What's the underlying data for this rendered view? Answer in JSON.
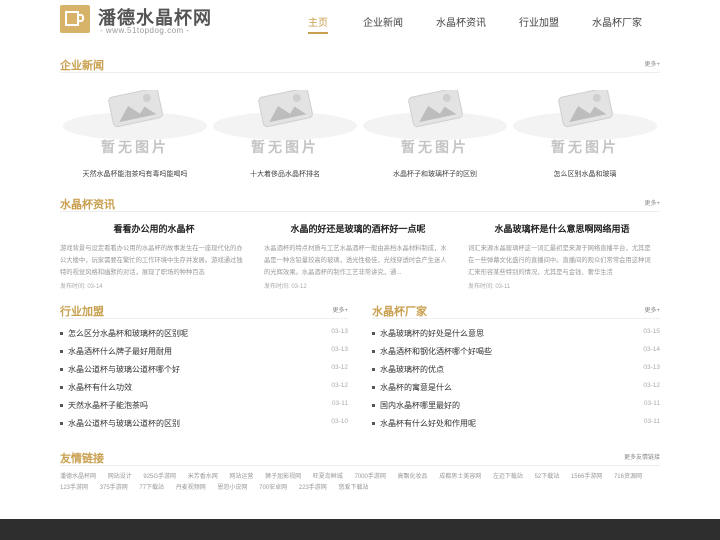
{
  "header": {
    "title": "潘德水晶杯网",
    "subtitle": "- www.51topdog.com -",
    "nav": [
      "主页",
      "企业新闻",
      "水晶杯资讯",
      "行业加盟",
      "水晶杯厂家"
    ]
  },
  "enterprise_news": {
    "title": "企业新闻",
    "more": "更多+",
    "placeholder": "暂无图片",
    "cards": [
      "天然水晶杯能泡茶吗有毒吗能喝吗",
      "十大着侈品水晶杯排名",
      "水晶杯子和玻璃杯子的区别",
      "怎么区别水晶和玻璃"
    ]
  },
  "crystal_info": {
    "title": "水晶杯资讯",
    "more": "更多+",
    "items": [
      {
        "title": "看看办公用的水晶杯",
        "body": "游戏背景与设定看看办公用的水晶杯的故事发生在一座现代化的办公大楼中，玩家需要在繁忙的工作环境中生存并发展。游戏通过独特的视觉风格和幽默的对话，展现了职场的种种百态",
        "time": "发布时间:  03-14"
      },
      {
        "title": "水晶的好还是玻璃的酒杯好一点呢",
        "body": "水晶酒杯的特点材质与工艺水晶酒杯一般由高档水晶材料制成，水晶是一种含铅量较高的玻璃，透光性极佳，光线穿透时会产生迷人的光辉效果。水晶酒杯的制作工艺非常讲究，通...",
        "time": "发布时间:  03-12"
      },
      {
        "title": "水晶玻璃杯是什么意思啊网络用语",
        "body": "词汇来源水晶玻璃杯这一词汇最初是来源于网络直播平台，尤其是在一些弹幕文化盛行的直播间中。直播间的观众们常常会用这种词汇来形容某些特别的情况，尤其是与金钱、奢华生活",
        "time": "发布时间:  03-11"
      }
    ]
  },
  "industry": {
    "title": "行业加盟",
    "more": "更多+",
    "rows": [
      {
        "text": "怎么区分水晶杯和玻璃杯的区别呢",
        "date": "03-13"
      },
      {
        "text": "水晶酒杯什么牌子最好用耐用",
        "date": "03-13"
      },
      {
        "text": "水晶公道杯与玻璃公道杯哪个好",
        "date": "03-12"
      },
      {
        "text": "水晶杯有什么功效",
        "date": "03-12"
      },
      {
        "text": "天然水晶杯子能泡茶吗",
        "date": "03-11"
      },
      {
        "text": "水晶公道杯与玻璃公道杯的区别",
        "date": "03-10"
      }
    ]
  },
  "factory": {
    "title": "水晶杯厂家",
    "more": "更多+",
    "rows": [
      {
        "text": "水晶玻璃杯的好处是什么意思",
        "date": "03-15"
      },
      {
        "text": "水晶酒杯和钢化酒杯哪个好喝些",
        "date": "03-14"
      },
      {
        "text": "水晶玻璃杯的优点",
        "date": "03-13"
      },
      {
        "text": "水晶杯的寓意是什么",
        "date": "03-12"
      },
      {
        "text": "国内水晶杯哪里最好的",
        "date": "03-11"
      },
      {
        "text": "水晶杯有什么好处和作用呢",
        "date": "03-11"
      }
    ]
  },
  "friend_links": {
    "title": "友情链接",
    "more": "更多友情链接",
    "links": [
      "潘德水晶杯网",
      "网站设计",
      "925G手游网",
      "米芳香水网",
      "网站运营",
      "狮子屈影视网",
      "旺夏岛鲜城",
      "7000手游网",
      "高飘化妆品",
      "成都男士美容网",
      "左迈下载站",
      "52下载站",
      "1566手游网",
      "716资源网",
      "123手游网",
      "375手游网",
      "77下载站",
      "丹麦视频网",
      "恩怨小说网",
      "700安卓网",
      "223手游网",
      "悠爱下载站"
    ]
  },
  "colors": {
    "accent": "#c9a050",
    "footer": "#2e2e2e"
  }
}
